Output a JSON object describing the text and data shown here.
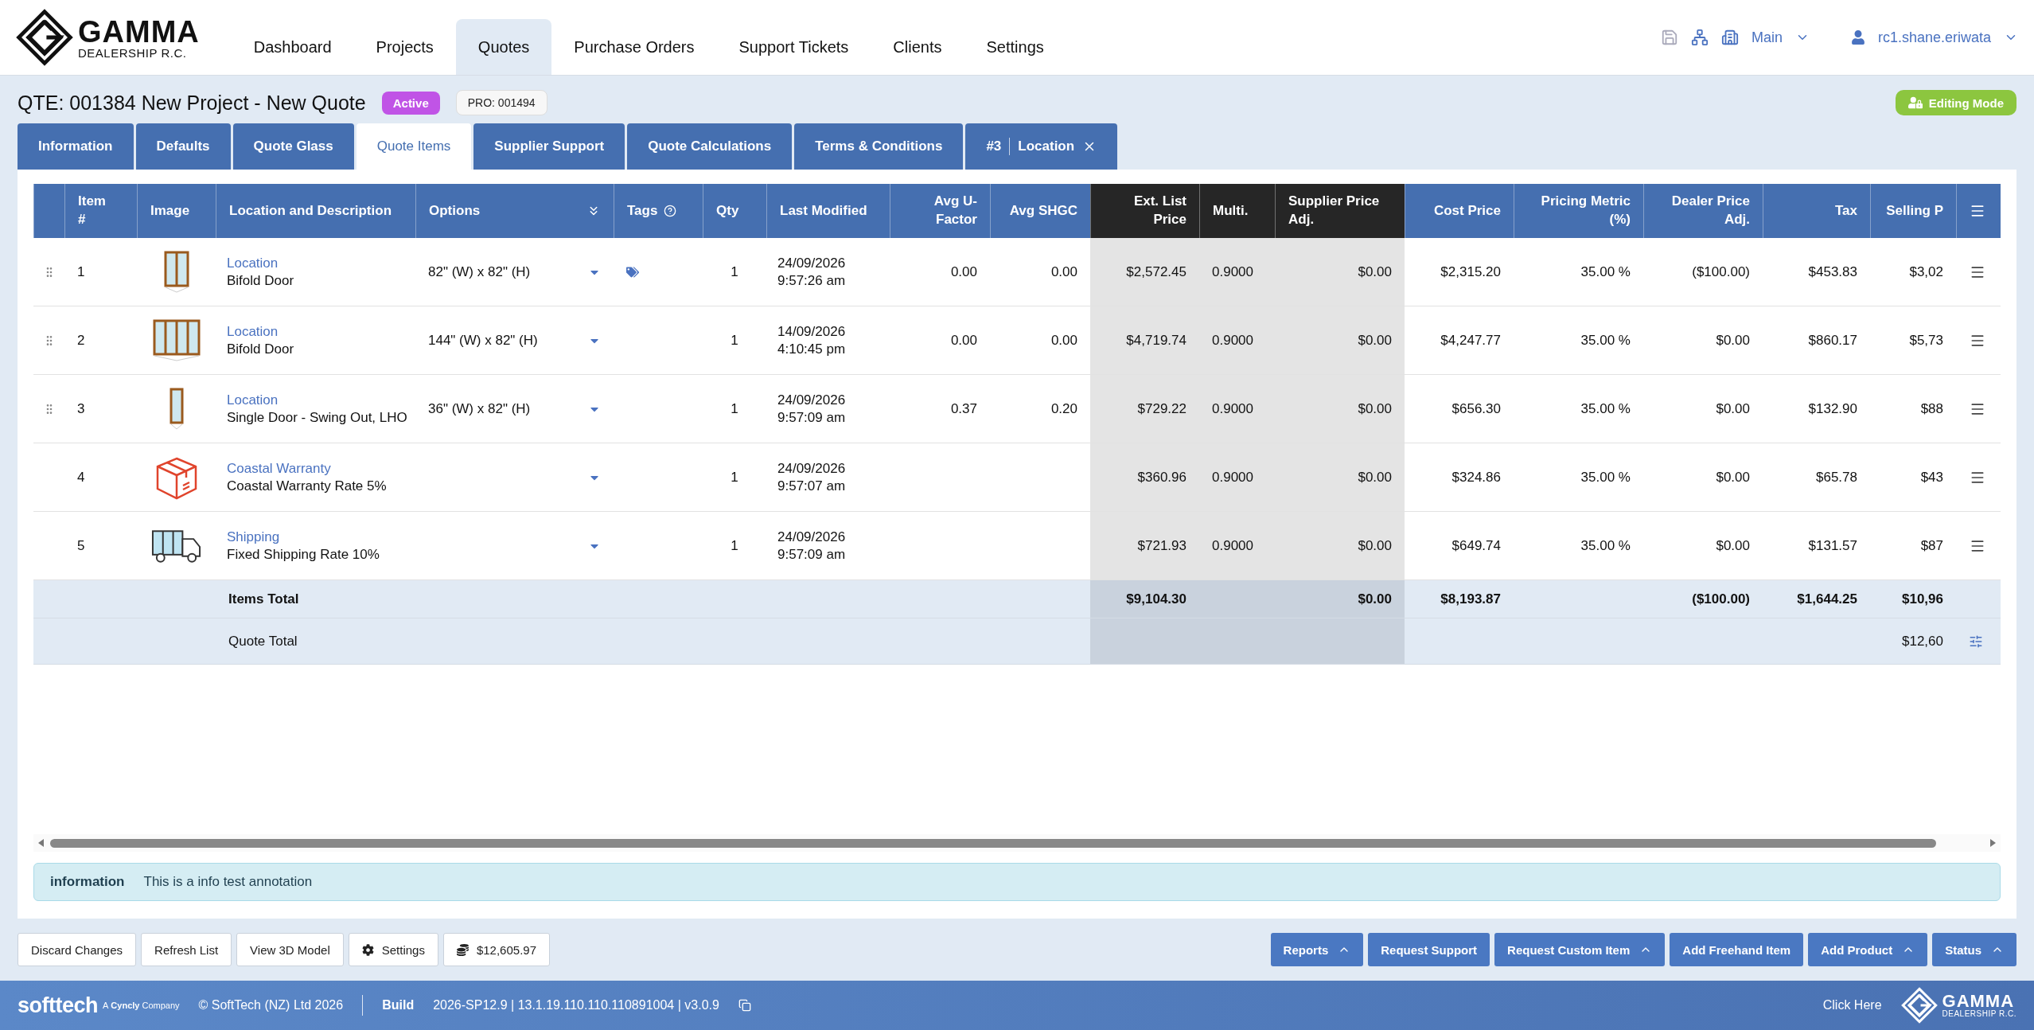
{
  "brand": {
    "name": "GAMMA",
    "tagline": "DEALERSHIP R.C."
  },
  "nav": [
    {
      "label": "Dashboard",
      "selected": false
    },
    {
      "label": "Projects",
      "selected": false
    },
    {
      "label": "Quotes",
      "selected": true
    },
    {
      "label": "Purchase Orders",
      "selected": false
    },
    {
      "label": "Support Tickets",
      "selected": false
    },
    {
      "label": "Clients",
      "selected": false
    },
    {
      "label": "Settings",
      "selected": false
    }
  ],
  "header_tools": {
    "branch": "Main",
    "user": "rc1.shane.eriwata"
  },
  "quote": {
    "title": "QTE: 001384 New Project - New Quote",
    "status": "Active",
    "project_ref": "PRO: 001494",
    "mode_button": "Editing Mode"
  },
  "tabs": [
    {
      "label": "Information",
      "selected": false
    },
    {
      "label": "Defaults",
      "selected": false
    },
    {
      "label": "Quote Glass",
      "selected": false
    },
    {
      "label": "Quote Items",
      "selected": true
    },
    {
      "label": "Supplier Support",
      "selected": false
    },
    {
      "label": "Quote Calculations",
      "selected": false
    },
    {
      "label": "Terms & Conditions",
      "selected": false
    },
    {
      "badge": "#3",
      "label": "Location",
      "selected": false,
      "closable": true
    }
  ],
  "table": {
    "columns": [
      {
        "label": "Item #",
        "kind": "standard"
      },
      {
        "label": "Image",
        "kind": "standard"
      },
      {
        "label": "Location and Description",
        "kind": "standard"
      },
      {
        "label": "Options",
        "kind": "standard"
      },
      {
        "label": "Tags",
        "kind": "standard"
      },
      {
        "label": "Qty",
        "kind": "standard"
      },
      {
        "label": "Last Modified",
        "kind": "standard"
      },
      {
        "label": "Avg U-Factor",
        "kind": "standard"
      },
      {
        "label": "Avg SHGC",
        "kind": "standard"
      },
      {
        "label": "Ext. List Price",
        "kind": "supplier"
      },
      {
        "label": "Multi.",
        "kind": "supplier"
      },
      {
        "label": "Supplier Price Adj.",
        "kind": "supplier"
      },
      {
        "label": "Cost Price",
        "kind": "standard"
      },
      {
        "label": "Pricing Metric (%)",
        "kind": "standard"
      },
      {
        "label": "Dealer Price Adj.",
        "kind": "standard"
      },
      {
        "label": "Tax",
        "kind": "standard"
      },
      {
        "label": "Selling P",
        "kind": "standard"
      }
    ],
    "rows": [
      {
        "kind": "product",
        "item": "1",
        "location": "Location",
        "description": "Bifold Door",
        "options": "82\" (W) x 82\" (H)",
        "tagged": true,
        "qty": "1",
        "modified_date": "24/09/2026",
        "modified_time": "9:57:26 am",
        "avg_u_factor": "0.00",
        "avg_shgc": "0.00",
        "ext_list_price": "$2,572.45",
        "multi": "0.9000",
        "supplier_price_adj": "$0.00",
        "cost_price": "$2,315.20",
        "pricing_metric": "35.00 %",
        "dealer_price_adj": "($100.00)",
        "tax": "$453.83",
        "selling_price": "$3,02"
      },
      {
        "kind": "product",
        "item": "2",
        "location": "Location",
        "description": "Bifold Door",
        "options": "144\" (W) x 82\" (H)",
        "tagged": false,
        "qty": "1",
        "modified_date": "14/09/2026",
        "modified_time": "4:10:45 pm",
        "avg_u_factor": "0.00",
        "avg_shgc": "0.00",
        "ext_list_price": "$4,719.74",
        "multi": "0.9000",
        "supplier_price_adj": "$0.00",
        "cost_price": "$4,247.77",
        "pricing_metric": "35.00 %",
        "dealer_price_adj": "$0.00",
        "tax": "$860.17",
        "selling_price": "$5,73"
      },
      {
        "kind": "product",
        "item": "3",
        "location": "Location",
        "description": "Single Door - Swing Out, LHO",
        "options": "36\" (W) x 82\" (H)",
        "tagged": false,
        "qty": "1",
        "modified_date": "24/09/2026",
        "modified_time": "9:57:09 am",
        "avg_u_factor": "0.37",
        "avg_shgc": "0.20",
        "ext_list_price": "$729.22",
        "multi": "0.9000",
        "supplier_price_adj": "$0.00",
        "cost_price": "$656.30",
        "pricing_metric": "35.00 %",
        "dealer_price_adj": "$0.00",
        "tax": "$132.90",
        "selling_price": "$88"
      },
      {
        "kind": "warranty",
        "item": "4",
        "location": "Coastal Warranty",
        "description": "Coastal Warranty Rate 5%",
        "tagged": false,
        "qty": "1",
        "modified_date": "24/09/2026",
        "modified_time": "9:57:07 am",
        "ext_list_price": "$360.96",
        "multi": "0.9000",
        "supplier_price_adj": "$0.00",
        "cost_price": "$324.86",
        "pricing_metric": "35.00 %",
        "dealer_price_adj": "$0.00",
        "tax": "$65.78",
        "selling_price": "$43"
      },
      {
        "kind": "shipping",
        "item": "5",
        "location": "Shipping",
        "description": "Fixed Shipping Rate 10%",
        "tagged": false,
        "qty": "1",
        "modified_date": "24/09/2026",
        "modified_time": "9:57:09 am",
        "ext_list_price": "$721.93",
        "multi": "0.9000",
        "supplier_price_adj": "$0.00",
        "cost_price": "$649.74",
        "pricing_metric": "35.00 %",
        "dealer_price_adj": "$0.00",
        "tax": "$131.57",
        "selling_price": "$87"
      }
    ],
    "items_total": {
      "label": "Items Total",
      "ext_list_price": "$9,104.30",
      "supplier_price_adj": "$0.00",
      "cost_price": "$8,193.87",
      "dealer_price_adj": "($100.00)",
      "tax": "$1,644.25",
      "selling_price": "$10,96"
    },
    "quote_total": {
      "label": "Quote Total",
      "selling_price": "$12,60"
    }
  },
  "annotation": {
    "kind": "information",
    "label": "information",
    "text": "This is a info test annotation"
  },
  "actions_left": [
    {
      "kind": "plain",
      "label": "Discard Changes"
    },
    {
      "kind": "plain",
      "label": "Refresh List"
    },
    {
      "kind": "plain",
      "label": "View 3D Model"
    },
    {
      "kind": "settings",
      "label": "Settings"
    },
    {
      "kind": "total",
      "label": "$12,605.97"
    }
  ],
  "actions_right": [
    {
      "label": "Reports",
      "menu": true
    },
    {
      "label": "Request Support",
      "menu": false
    },
    {
      "label": "Request Custom Item",
      "menu": true
    },
    {
      "label": "Add Freehand Item",
      "menu": false
    },
    {
      "label": "Add Product",
      "menu": true
    },
    {
      "label": "Status",
      "menu": true
    }
  ],
  "footer": {
    "company": "softtech",
    "company_prefix": "A",
    "company_parent": "Cyncly",
    "company_suffix": "Company",
    "copyright": "© SoftTech (NZ) Ltd 2026",
    "build_label": "Build",
    "build": "2026-SP12.9 | 13.1.19.110.110.110891004 | v3.0.9",
    "link": "Click Here",
    "brand_name": "GAMMA",
    "brand_tagline": "DEALERSHIP R.C."
  }
}
